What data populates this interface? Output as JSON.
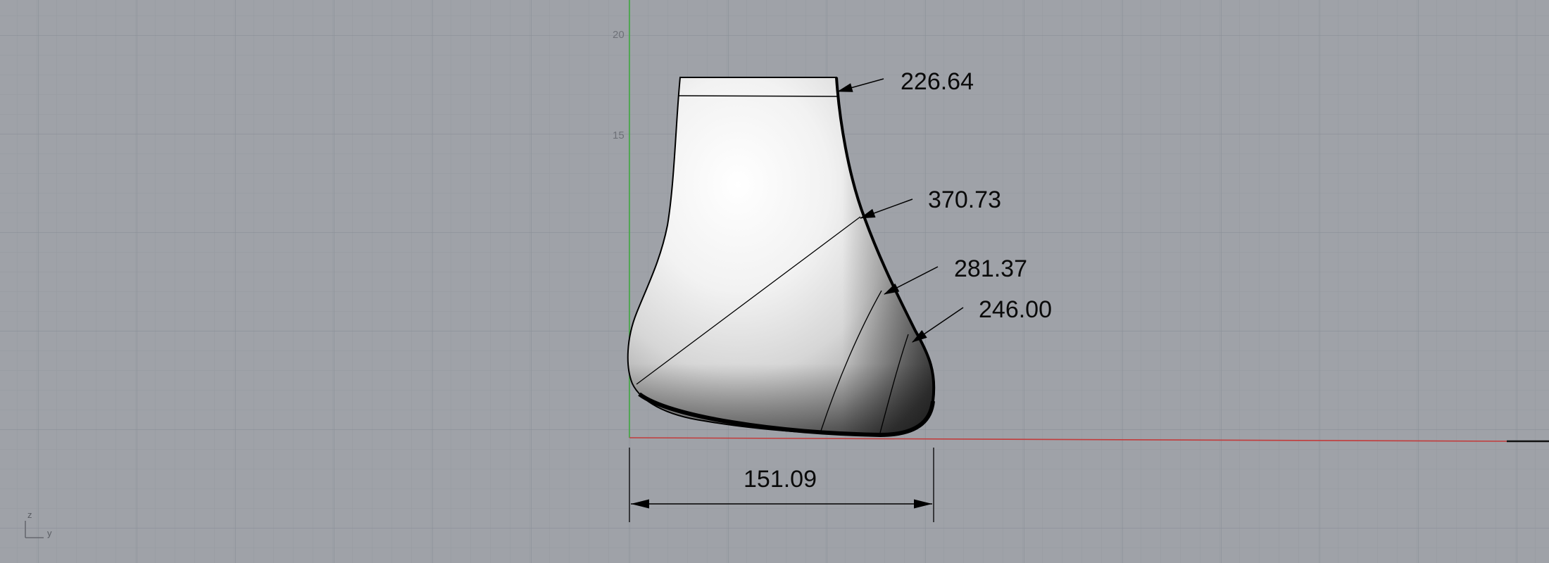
{
  "viewport": {
    "background": "#9fa2a8",
    "grid_minor_color": "#959aa1",
    "grid_major_color": "#8a8f97",
    "x_axis_color": "#c23b3b",
    "z_axis_color": "#3fa83f"
  },
  "ruler": {
    "ticks": [
      "20",
      "15"
    ]
  },
  "dimensions": {
    "top_circumference": "226.64",
    "instep_circumference": "370.73",
    "ball_circumference": "281.37",
    "toe_circumference": "246.00",
    "foot_length": "151.09"
  },
  "axis_gizmo": {
    "vertical_label": "z",
    "horizontal_label": "y"
  },
  "icons": {
    "arrowhead": "arrowhead-icon",
    "axis_gizmo": "axis-gizmo-icon"
  }
}
